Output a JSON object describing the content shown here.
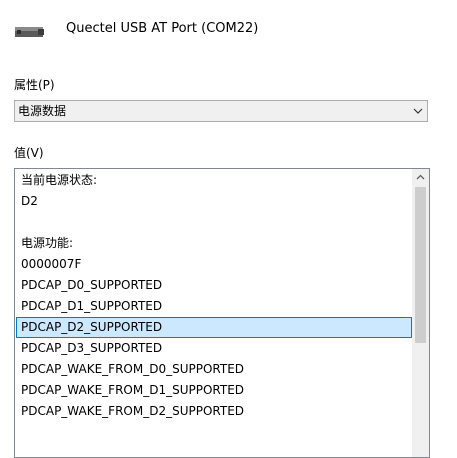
{
  "device": {
    "icon": "usb-port-device-icon",
    "name": "Quectel USB AT Port (COM22)"
  },
  "property": {
    "label": "属性(P)",
    "selected_value": "电源数据"
  },
  "value": {
    "label": "值(V)",
    "items": [
      "当前电源状态:",
      "D2",
      "",
      "电源功能:",
      "0000007F",
      "PDCAP_D0_SUPPORTED",
      "PDCAP_D1_SUPPORTED",
      "PDCAP_D2_SUPPORTED",
      "PDCAP_D3_SUPPORTED",
      "PDCAP_WAKE_FROM_D0_SUPPORTED",
      "PDCAP_WAKE_FROM_D1_SUPPORTED",
      "PDCAP_WAKE_FROM_D2_SUPPORTED"
    ],
    "selected_item": "PDCAP_D2_SUPPORTED"
  },
  "colors": {
    "selection_fill": "#cce8ff",
    "selection_border": "#0078d7",
    "scrollbar_thumb": "#cdcdcd"
  }
}
